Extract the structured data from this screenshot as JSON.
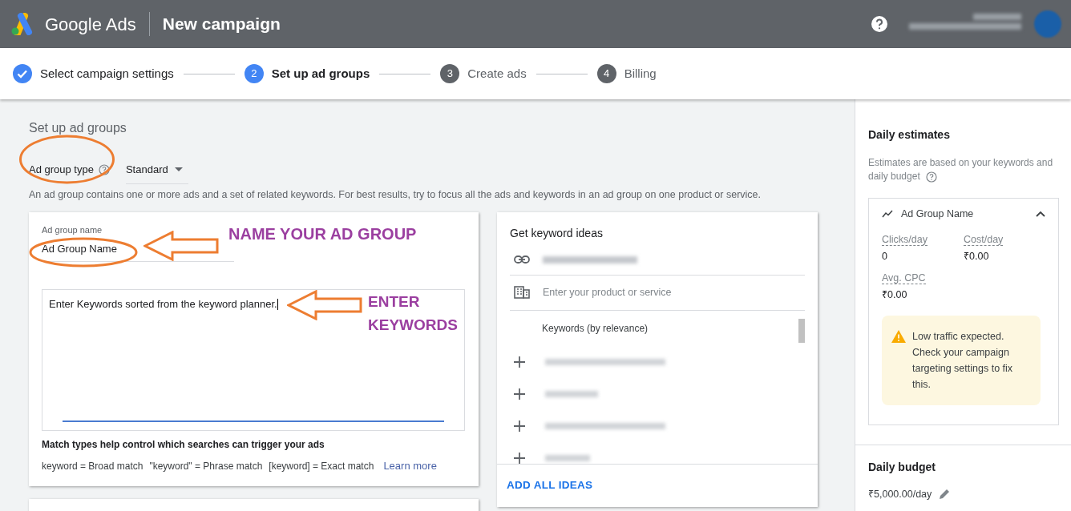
{
  "header": {
    "product": "Google Ads",
    "title": "New campaign"
  },
  "steps": [
    {
      "label": "Select campaign settings",
      "done": true,
      "selected": false
    },
    {
      "label": "Set up ad groups",
      "number": "2",
      "done": false,
      "selected": true
    },
    {
      "label": "Create ads",
      "number": "3",
      "done": false,
      "selected": false
    },
    {
      "label": "Billing",
      "number": "4",
      "done": false,
      "selected": false
    }
  ],
  "section": {
    "title": "Set up ad groups",
    "type_label": "Ad group type",
    "type_value": "Standard",
    "description": "An ad group contains one or more ads and a set of related keywords. For best results, try to focus all the ads and keywords in an ad group on one product or service."
  },
  "ad_group_card": {
    "name_label": "Ad group name",
    "name_value": "Ad Group Name",
    "keywords_value": "Enter Keywords sorted from the keyword planner.",
    "match_title": "Match types help control which searches can trigger your ads",
    "match_types": [
      "keyword = Broad match",
      "\"keyword\" = Phrase match",
      "[keyword] = Exact match"
    ],
    "learn_more": "Learn more"
  },
  "keyword_ideas": {
    "title": "Get keyword ideas",
    "product_placeholder": "Enter your product or service",
    "list_header": "Keywords (by relevance)",
    "action": "ADD ALL IDEAS"
  },
  "annotations": [
    {
      "text": "NAME YOUR AD GROUP"
    },
    {
      "text": "ENTER KEYWORDS"
    }
  ],
  "estimates": {
    "title": "Daily estimates",
    "note": "Estimates are based on your keywords and daily budget",
    "group": {
      "name": "Ad Group Name",
      "expanded": true,
      "metrics": [
        {
          "label": "Clicks/day",
          "value": "0"
        },
        {
          "label": "Cost/day",
          "value": "₹0.00"
        },
        {
          "label": "Avg. CPC",
          "value": "₹0.00"
        }
      ]
    },
    "warning": "Low traffic expected. Check your campaign targeting settings to fix this."
  },
  "budget": {
    "title": "Daily budget",
    "value": "₹5,000.00/day"
  }
}
